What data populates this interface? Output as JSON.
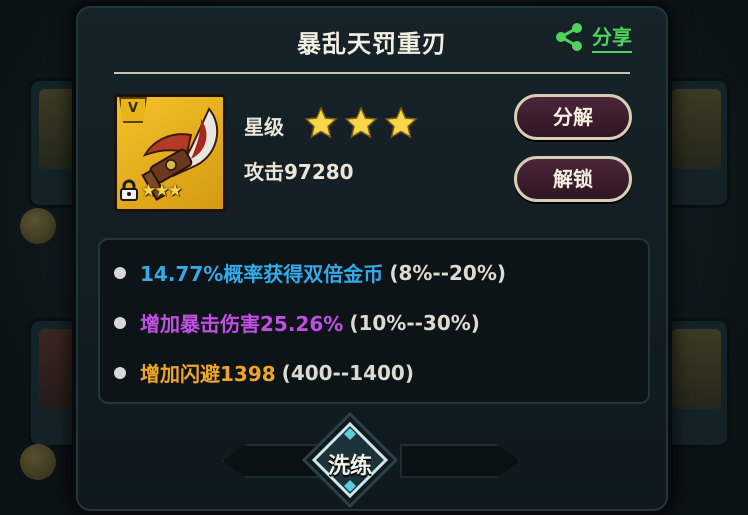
{
  "dialog": {
    "title": "暴乱天罚重刃",
    "share_label": "分享",
    "star_label": "星级",
    "star_count": 3,
    "attack_text": "攻击97280",
    "icon_badge": "V",
    "icon_stars": "★★★"
  },
  "buttons": {
    "split_label": "分解",
    "unlock_label": "解锁",
    "wash_label": "洗练"
  },
  "attributes": [
    {
      "main": "14.77%概率获得双倍金币",
      "range": "(8%--20%)",
      "color": "#36a9e8"
    },
    {
      "main": "增加暴击伤害25.26%",
      "range": "(10%--30%)",
      "color": "#c14fe4"
    },
    {
      "main": "增加闪避1398",
      "range": "(400--1400)",
      "color": "#f0a52a"
    }
  ],
  "icons": {
    "share": "share-icon",
    "star": "star-icon",
    "lock": "lock-icon",
    "weapon": "blade-weapon-icon"
  },
  "colors": {
    "accent_green": "#4fd35a",
    "star_gold": "#f8d64a",
    "icon_gold": "#f4c22a"
  }
}
